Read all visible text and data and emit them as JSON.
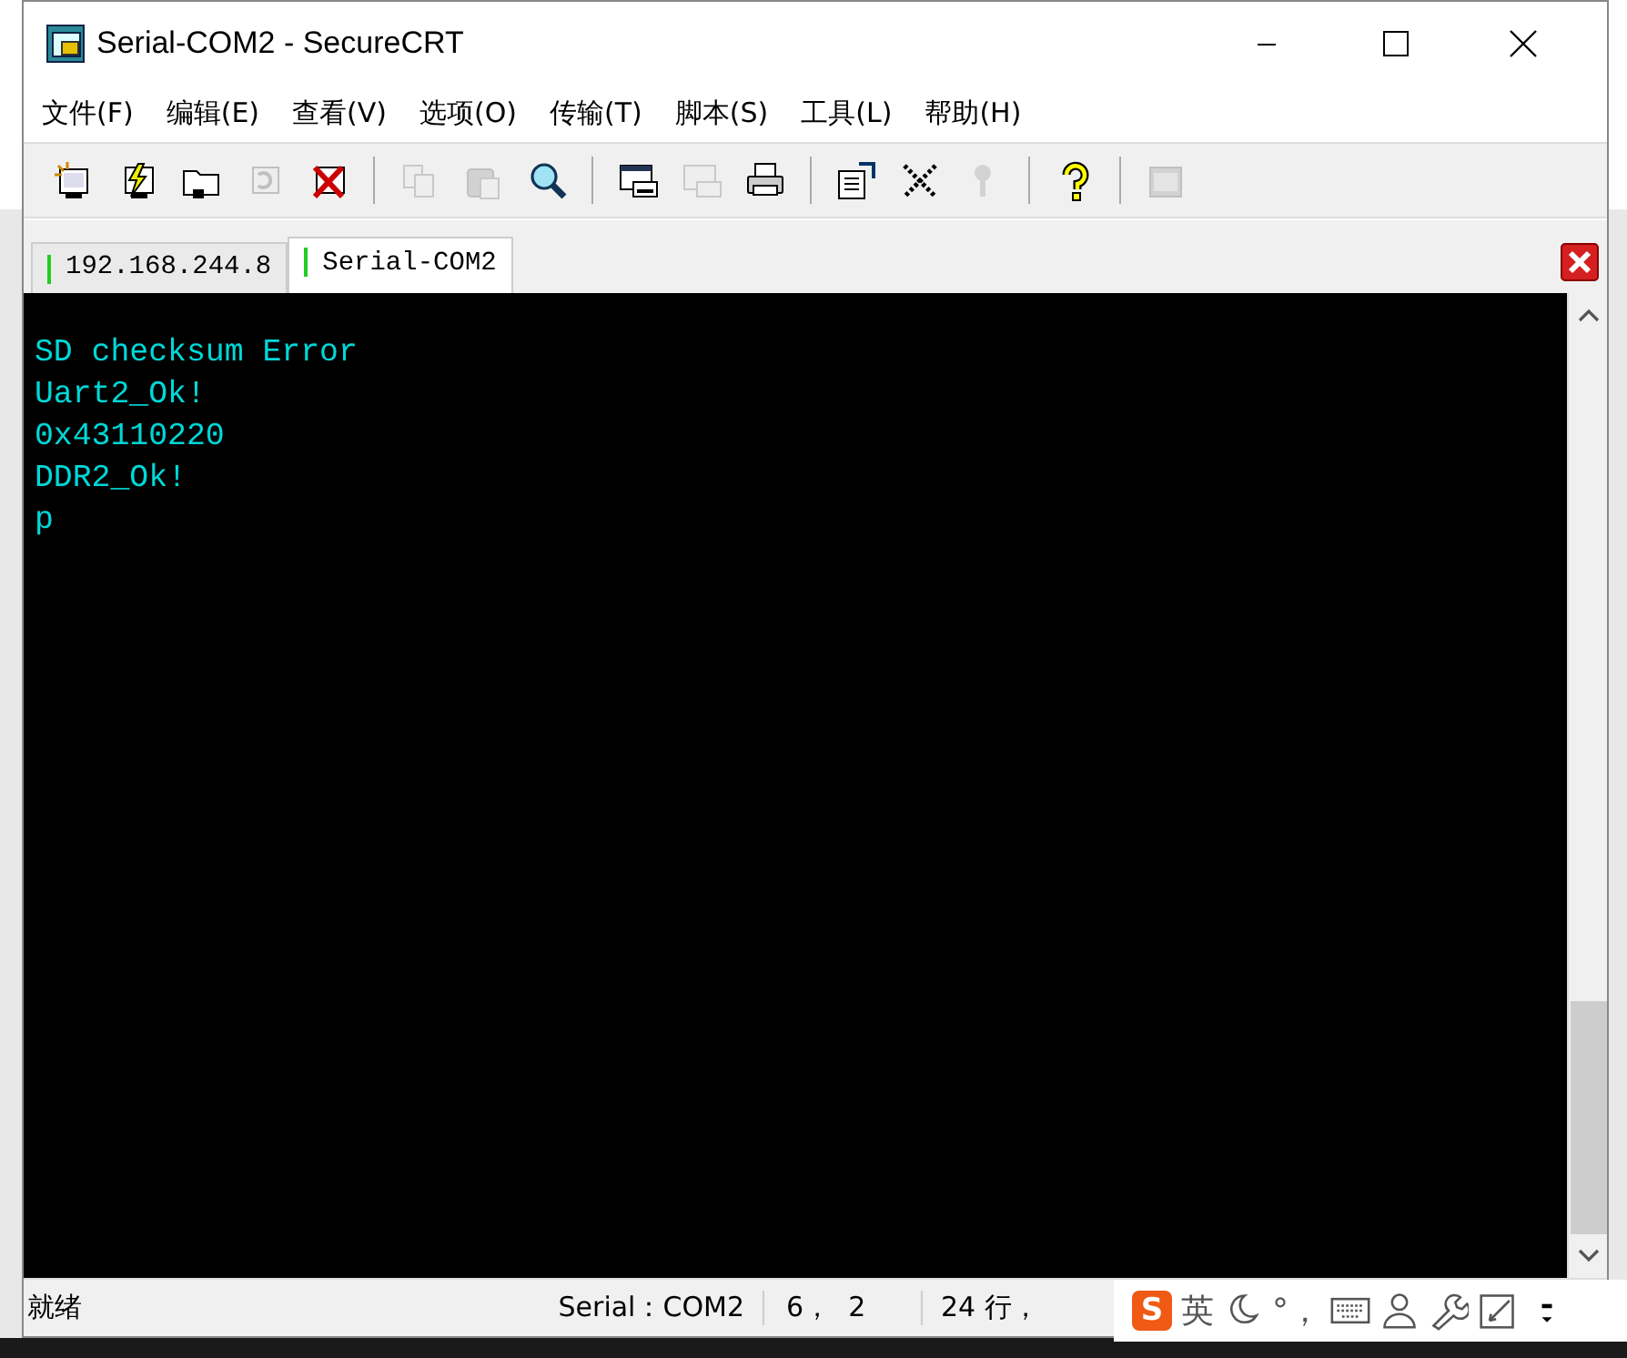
{
  "window": {
    "title": "Serial-COM2 - SecureCRT"
  },
  "menu": [
    "文件(F)",
    "编辑(E)",
    "查看(V)",
    "选项(O)",
    "传输(T)",
    "脚本(S)",
    "工具(L)",
    "帮助(H)"
  ],
  "toolbar": [
    {
      "kind": "button",
      "disabled": false
    },
    {
      "kind": "button",
      "disabled": false
    },
    {
      "kind": "button",
      "disabled": false
    },
    {
      "kind": "button",
      "disabled": true
    },
    {
      "kind": "button",
      "disabled": false
    },
    {
      "kind": "separator"
    },
    {
      "kind": "button",
      "disabled": true
    },
    {
      "kind": "button",
      "disabled": true
    },
    {
      "kind": "button",
      "disabled": false
    },
    {
      "kind": "separator"
    },
    {
      "kind": "button",
      "disabled": false
    },
    {
      "kind": "button",
      "disabled": true
    },
    {
      "kind": "button",
      "disabled": false
    },
    {
      "kind": "separator"
    },
    {
      "kind": "button",
      "disabled": false
    },
    {
      "kind": "button",
      "disabled": false
    },
    {
      "kind": "button",
      "disabled": true
    },
    {
      "kind": "separator"
    },
    {
      "kind": "button",
      "disabled": false
    },
    {
      "kind": "separator"
    },
    {
      "kind": "button",
      "disabled": true
    }
  ],
  "tabs": [
    {
      "label": "192.168.244.8",
      "selected": false
    },
    {
      "label": "Serial-COM2",
      "selected": true
    }
  ],
  "terminal": {
    "lines": [
      "SD checksum Error",
      "Uart2_Ok!",
      "0x43110220",
      "DDR2_Ok!",
      "p"
    ]
  },
  "status_bar": [
    "就绪",
    "Serial：COM2",
    "6，  2",
    "24 行，"
  ],
  "ime_bar": [
    {
      "kind": "logo",
      "text": "S"
    },
    {
      "kind": "text",
      "text": "英"
    },
    {
      "kind": "icon"
    },
    {
      "kind": "text",
      "text": "°，"
    },
    {
      "kind": "icon"
    },
    {
      "kind": "icon"
    },
    {
      "kind": "icon"
    },
    {
      "kind": "icon"
    },
    {
      "kind": "icon"
    }
  ]
}
